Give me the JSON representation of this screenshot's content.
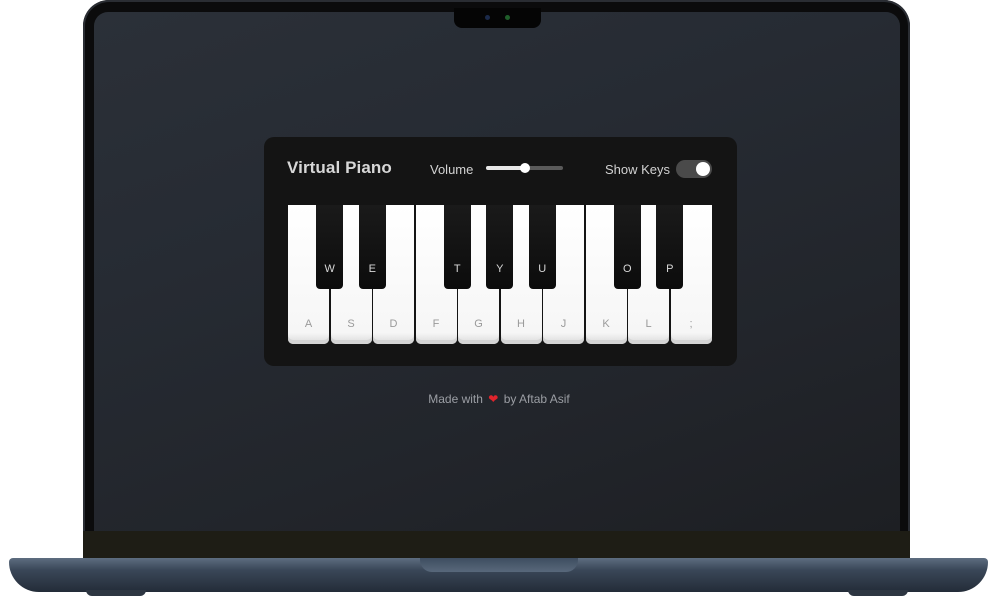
{
  "app": {
    "title": "Virtual Piano",
    "volume_label": "Volume",
    "volume_value": 0.5,
    "show_keys_label": "Show Keys",
    "show_keys_on": true
  },
  "keyboard": {
    "white_keys": [
      "A",
      "S",
      "D",
      "F",
      "G",
      "H",
      "J",
      "K",
      "L",
      ";"
    ],
    "black_keys": [
      {
        "label": "W",
        "after_white": 0
      },
      {
        "label": "E",
        "after_white": 1
      },
      {
        "label": "T",
        "after_white": 3
      },
      {
        "label": "Y",
        "after_white": 4
      },
      {
        "label": "U",
        "after_white": 5
      },
      {
        "label": "O",
        "after_white": 7
      },
      {
        "label": "P",
        "after_white": 8
      }
    ]
  },
  "footer": {
    "prefix": "Made with",
    "icon": "heart-icon",
    "suffix": "by Aftab Asif"
  },
  "colors": {
    "panel": "#141414",
    "screen": "#262b33",
    "heart": "#e0242c"
  }
}
